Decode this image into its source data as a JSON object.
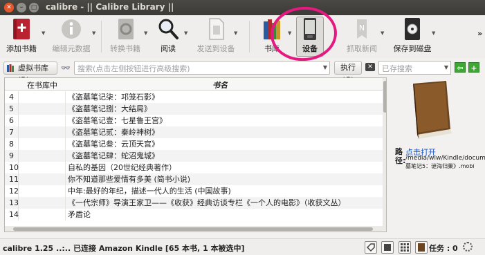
{
  "window": {
    "title": "calibre - || Calibre Library ||",
    "close": "✕",
    "minimize": "–",
    "maximize": "□"
  },
  "toolbar": {
    "add_books": "添加书籍",
    "edit_metadata": "编辑元数据",
    "convert_books": "转换书籍",
    "view": "阅读",
    "send_to_device": "发送到设备",
    "library": "书库",
    "device": "设备",
    "fetch_news": "抓取新闻",
    "save_to_disk": "保存到磁盘",
    "more": "»"
  },
  "search": {
    "virtual_library": "虚拟书库(R)",
    "placeholder": "搜索(点击左侧按钮进行高级搜索)",
    "execute": "执行(G)",
    "saved_searches": "已存搜索"
  },
  "table": {
    "columns": [
      "在书库中",
      "书名"
    ],
    "rows": [
      {
        "n": "4",
        "title": "《盗墓笔记柒：邛笼石影》"
      },
      {
        "n": "5",
        "title": "《盗墓笔记捌：大结局》"
      },
      {
        "n": "6",
        "title": "《盗墓笔记壹：七星鲁王宫》"
      },
      {
        "n": "7",
        "title": "《盗墓笔记贰：秦岭神树》"
      },
      {
        "n": "8",
        "title": "《盗墓笔记叁：云顶天宫》"
      },
      {
        "n": "9",
        "title": "《盗墓笔记肆：蛇沼鬼城》"
      },
      {
        "n": "10",
        "title": "自私的基因（20世纪经典著作）"
      },
      {
        "n": "11",
        "title": "你不知道那些爱情有多美 (简书小说)"
      },
      {
        "n": "12",
        "title": "中年:最好的年纪，描述一代人的生活 (中国故事)"
      },
      {
        "n": "13",
        "title": "《一代宗师》导演王家卫——《收获》经典访谈专栏《一个人的电影》（收获文丛）"
      },
      {
        "n": "14",
        "title": "矛盾论"
      }
    ]
  },
  "details": {
    "path_label": "路\n径:",
    "open_link": "点击打开",
    "path_value": "/media/wlw/Kindle/documer",
    "file_value": "墓笔记5：谜海归巢》.mobi"
  },
  "status": {
    "text": "calibre 1.25 ..:.. 已连接 Amazon Kindle   [65 本书, 1 本被选中]",
    "jobs": "任务 : 0"
  },
  "colors": {
    "highlight": "#e5197f",
    "link": "#1a56c9",
    "accent_green": "#3fa535"
  }
}
